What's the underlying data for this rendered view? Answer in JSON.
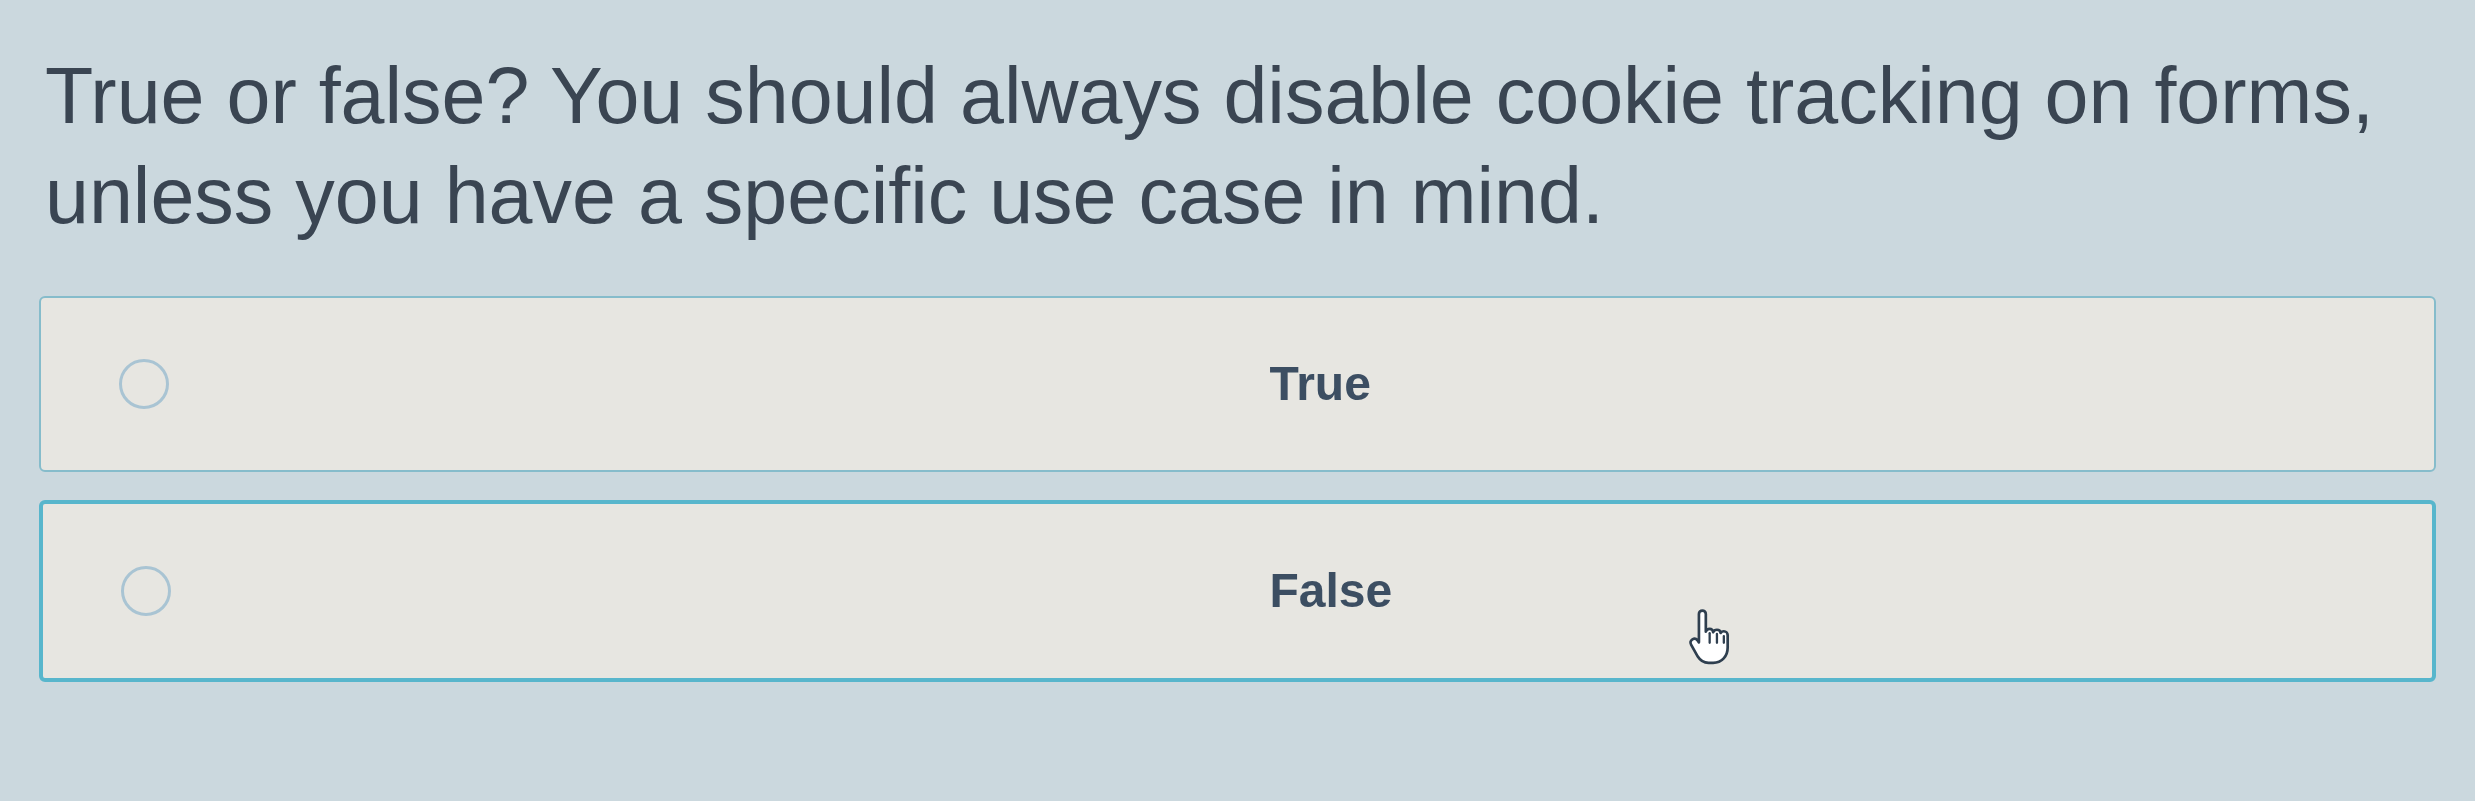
{
  "question": "True or false? You should always disable cookie tracking on forms, unless you have a specific use case in mind.",
  "options": [
    {
      "label": "True",
      "selected": false,
      "hovered": false
    },
    {
      "label": "False",
      "selected": false,
      "hovered": true
    }
  ]
}
